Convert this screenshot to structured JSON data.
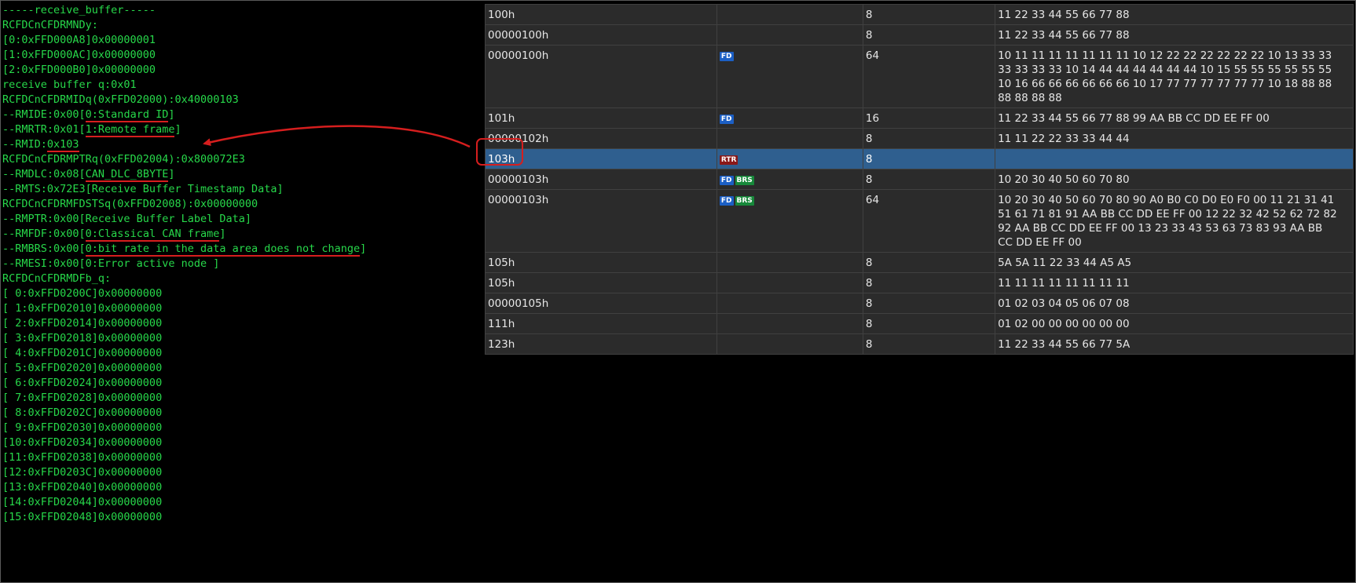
{
  "terminal": {
    "lines": [
      {
        "segments": [
          {
            "text": "-----receive_buffer-----"
          }
        ]
      },
      {
        "segments": [
          {
            "text": "RCFDCnCFDRMNDy:"
          }
        ]
      },
      {
        "segments": [
          {
            "text": "[0:0xFFD000A8]0x00000001"
          }
        ]
      },
      {
        "segments": [
          {
            "text": "[1:0xFFD000AC]0x00000000"
          }
        ]
      },
      {
        "segments": [
          {
            "text": "[2:0xFFD000B0]0x00000000"
          }
        ]
      },
      {
        "segments": [
          {
            "text": "receive buffer q:0x01"
          }
        ]
      },
      {
        "segments": [
          {
            "text": "RCFDCnCFDRMIDq(0xFFD02000):0x40000103"
          }
        ]
      },
      {
        "segments": [
          {
            "text": "--RMIDE:0x00["
          },
          {
            "text": "0:Standard ID",
            "underline": true
          },
          {
            "text": "]"
          }
        ]
      },
      {
        "segments": [
          {
            "text": "--RMRTR:0x01["
          },
          {
            "text": "1:Remote frame",
            "underline": true
          },
          {
            "text": "]"
          }
        ]
      },
      {
        "segments": [
          {
            "text": "--RMID:"
          },
          {
            "text": "0x103",
            "underline": true
          }
        ]
      },
      {
        "segments": [
          {
            "text": "RCFDCnCFDRMPTRq(0xFFD02004):0x800072E3"
          }
        ]
      },
      {
        "segments": [
          {
            "text": "--RMDLC:0x08["
          },
          {
            "text": "CAN_DLC_8BYTE",
            "underline": true
          },
          {
            "text": "]"
          }
        ]
      },
      {
        "segments": [
          {
            "text": "--RMTS:0x72E3[Receive Buffer Timestamp Data]"
          }
        ]
      },
      {
        "segments": [
          {
            "text": "RCFDCnCFDRMFDSTSq(0xFFD02008):0x00000000"
          }
        ]
      },
      {
        "segments": [
          {
            "text": "--RMPTR:0x00[Receive Buffer Label Data]"
          }
        ]
      },
      {
        "segments": [
          {
            "text": "--RMFDF:0x00["
          },
          {
            "text": "0:Classical CAN frame",
            "underline": true
          },
          {
            "text": "]"
          }
        ]
      },
      {
        "segments": [
          {
            "text": "--RMBRS:0x00["
          },
          {
            "text": "0:bit rate in the data area does not change",
            "underline": true
          },
          {
            "text": "]"
          }
        ]
      },
      {
        "segments": [
          {
            "text": "--RMESI:0x00[0:Error active node ]"
          }
        ]
      },
      {
        "segments": [
          {
            "text": "RCFDCnCFDRMDFb_q:"
          }
        ]
      },
      {
        "segments": [
          {
            "text": "[ 0:0xFFD0200C]0x00000000"
          }
        ]
      },
      {
        "segments": [
          {
            "text": "[ 1:0xFFD02010]0x00000000"
          }
        ]
      },
      {
        "segments": [
          {
            "text": "[ 2:0xFFD02014]0x00000000"
          }
        ]
      },
      {
        "segments": [
          {
            "text": "[ 3:0xFFD02018]0x00000000"
          }
        ]
      },
      {
        "segments": [
          {
            "text": "[ 4:0xFFD0201C]0x00000000"
          }
        ]
      },
      {
        "segments": [
          {
            "text": "[ 5:0xFFD02020]0x00000000"
          }
        ]
      },
      {
        "segments": [
          {
            "text": "[ 6:0xFFD02024]0x00000000"
          }
        ]
      },
      {
        "segments": [
          {
            "text": "[ 7:0xFFD02028]0x00000000"
          }
        ]
      },
      {
        "segments": [
          {
            "text": "[ 8:0xFFD0202C]0x00000000"
          }
        ]
      },
      {
        "segments": [
          {
            "text": "[ 9:0xFFD02030]0x00000000"
          }
        ]
      },
      {
        "segments": [
          {
            "text": "[10:0xFFD02034]0x00000000"
          }
        ]
      },
      {
        "segments": [
          {
            "text": "[11:0xFFD02038]0x00000000"
          }
        ]
      },
      {
        "segments": [
          {
            "text": "[12:0xFFD0203C]0x00000000"
          }
        ]
      },
      {
        "segments": [
          {
            "text": "[13:0xFFD02040]0x00000000"
          }
        ]
      },
      {
        "segments": [
          {
            "text": "[14:0xFFD02044]0x00000000"
          }
        ]
      },
      {
        "segments": [
          {
            "text": "[15:0xFFD02048]0x00000000"
          }
        ]
      }
    ]
  },
  "can_table": {
    "rows": [
      {
        "id": "100h",
        "flags": [],
        "dlc": "8",
        "data": "11 22 33 44 55 66 77 88"
      },
      {
        "id": "00000100h",
        "flags": [],
        "dlc": "8",
        "data": "11 22 33 44 55 66 77 88"
      },
      {
        "id": "00000100h",
        "flags": [
          "FD"
        ],
        "dlc": "64",
        "data": "10 11 11 11 11 11 11 11 10 12 22 22 22 22 22 22 10 13 33 33 33 33 33 33 10 14 44 44 44 44 44 44 10 15 55 55 55 55 55 55 10 16 66 66 66 66 66 66 10 17 77 77 77 77 77 77 10 18 88 88 88 88 88 88"
      },
      {
        "id": "101h",
        "flags": [
          "FD"
        ],
        "dlc": "16",
        "data": "11 22 33 44 55 66 77 88 99 AA BB CC DD EE FF 00"
      },
      {
        "id": "00000102h",
        "flags": [],
        "dlc": "8",
        "data": "11 11 22 22 33 33 44 44"
      },
      {
        "id": "103h",
        "flags": [
          "RTR"
        ],
        "dlc": "8",
        "data": "",
        "selected": true
      },
      {
        "id": "00000103h",
        "flags": [
          "FD",
          "BRS"
        ],
        "dlc": "8",
        "data": "10 20 30 40 50 60 70 80"
      },
      {
        "id": "00000103h",
        "flags": [
          "FD",
          "BRS"
        ],
        "dlc": "64",
        "data": "10 20 30 40 50 60 70 80 90 A0 B0 C0 D0 E0 F0 00 11 21 31 41 51 61 71 81 91 AA BB CC DD EE FF 00 12 22 32 42 52 62 72 82 92 AA BB CC DD EE FF 00 13 23 33 43 53 63 73 83 93 AA BB CC DD EE FF 00"
      },
      {
        "id": "105h",
        "flags": [],
        "dlc": "8",
        "data": "5A 5A 11 22 33 44 A5 A5"
      },
      {
        "id": "105h",
        "flags": [],
        "dlc": "8",
        "data": "11 11 11 11 11 11 11 11"
      },
      {
        "id": "00000105h",
        "flags": [],
        "dlc": "8",
        "data": "01 02 03 04 05 06 07 08"
      },
      {
        "id": "111h",
        "flags": [],
        "dlc": "8",
        "data": "01 02 00 00 00 00 00 00"
      },
      {
        "id": "123h",
        "flags": [],
        "dlc": "8",
        "data": "11 22 33 44 55 66 77 5A"
      }
    ]
  },
  "colors": {
    "terminal_text": "#27d84a",
    "annotation": "#d61e1e",
    "selected_row": "#2f5f8f",
    "fd_badge": "#1c5fc4",
    "brs_badge": "#17883a",
    "rtr_badge": "#8a1818"
  }
}
